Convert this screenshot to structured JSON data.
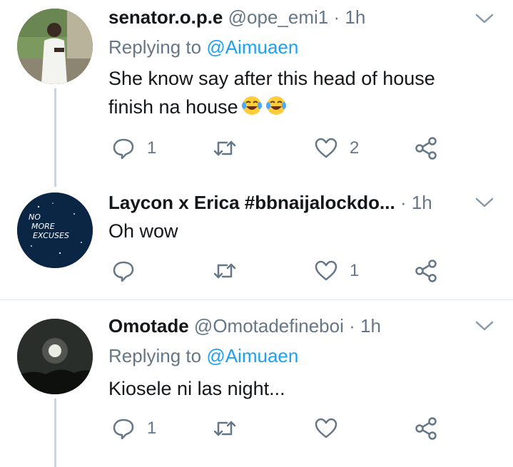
{
  "tweets": [
    {
      "name": "senator.o.p.e",
      "handle": "@ope_emi1",
      "separator": "·",
      "time": "1h",
      "replying_prefix": "Replying to",
      "replying_to": "@Aimuaen",
      "text_line1": "She know say after this head of house",
      "text_line2": "finish na house",
      "emojis": [
        "face-with-tears-of-joy",
        "face-with-tears-of-joy"
      ],
      "reply_count": "1",
      "retweet_count": "",
      "like_count": "2"
    },
    {
      "name": "Laycon x Erica #bbnaijalockdo...",
      "handle": "",
      "separator": "·",
      "time": "1h",
      "text": "Oh wow",
      "avatar_text": [
        "NO",
        "MORE",
        "EXCUSES"
      ],
      "reply_count": "",
      "retweet_count": "",
      "like_count": "1"
    },
    {
      "name": "Omotade",
      "handle": "@Omotadefineboi",
      "separator": "·",
      "time": "1h",
      "replying_prefix": "Replying to",
      "replying_to": "@Aimuaen",
      "text": "Kiosele ni las night...",
      "reply_count": "1",
      "retweet_count": "",
      "like_count": ""
    }
  ],
  "colors": {
    "name": "#14171a",
    "meta": "#657786",
    "link": "#1da1f2",
    "thread_line": "#cdd5dc",
    "icon": "#657786"
  }
}
